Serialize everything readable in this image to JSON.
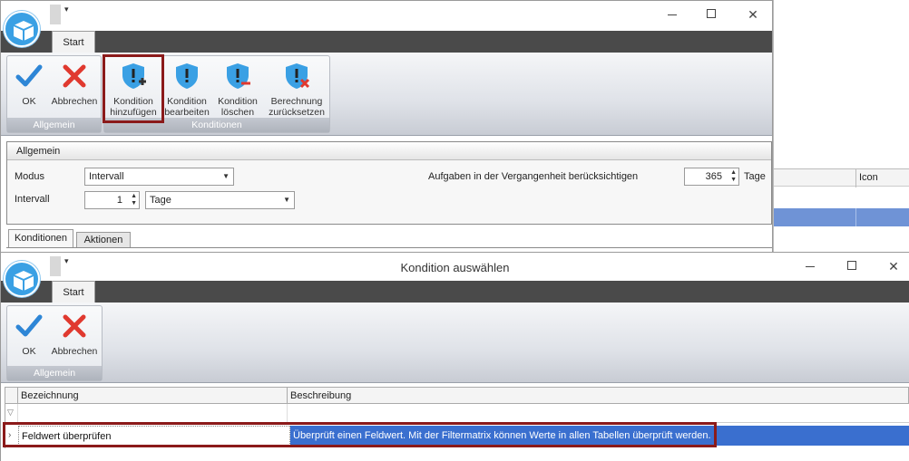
{
  "background_app": {
    "column_icon": "Icon"
  },
  "window1": {
    "tab_start": "Start",
    "ribbon": {
      "ok": "OK",
      "cancel": "Abbrechen",
      "add_condition": [
        "Kondition",
        "hinzufügen"
      ],
      "edit_condition": [
        "Kondition",
        "bearbeiten"
      ],
      "delete_condition": [
        "Kondition",
        "löschen"
      ],
      "reset_calc": [
        "Berechnung",
        "zurücksetzen"
      ],
      "group_general": "Allgemein",
      "group_conditions": "Konditionen"
    },
    "form": {
      "section_title": "Allgemein",
      "mode_label": "Modus",
      "mode_value": "Intervall",
      "interval_label": "Intervall",
      "interval_value": "1",
      "interval_unit": "Tage",
      "past_tasks_label": "Aufgaben in der Vergangenheit berücksichtigen",
      "past_tasks_value": "365",
      "past_tasks_unit": "Tage"
    },
    "subtabs": [
      "Konditionen",
      "Aktionen"
    ]
  },
  "window2": {
    "title": "Kondition auswählen",
    "tab_start": "Start",
    "ribbon": {
      "ok": "OK",
      "cancel": "Abbrechen",
      "group_general": "Allgemein"
    },
    "grid": {
      "columns": [
        "Bezeichnung",
        "Beschreibung"
      ],
      "rows": [
        {
          "name": "Feldwert überprüfen",
          "description": "Überprüft einen Feldwert. Mit der Filtermatrix können Werte in allen Tabellen überprüft werden."
        }
      ]
    }
  },
  "colors": {
    "accent_blue": "#3a6fcf",
    "highlight_red": "#8b1a1a",
    "tab_dark": "#4a4a4a"
  },
  "icons": [
    "app-logo-icon",
    "checkmark-icon",
    "cross-icon",
    "shield-plus-icon",
    "shield-edit-icon",
    "shield-minus-icon",
    "shield-reset-icon",
    "minimize-icon",
    "maximize-icon",
    "close-icon",
    "filter-icon",
    "row-pointer-icon"
  ]
}
